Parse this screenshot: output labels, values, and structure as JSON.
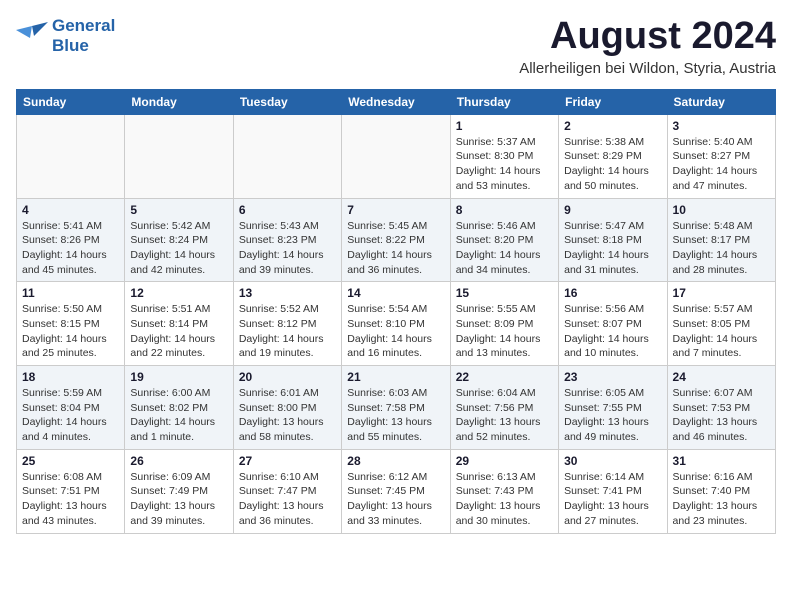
{
  "header": {
    "logo_line1": "General",
    "logo_line2": "Blue",
    "month": "August 2024",
    "location": "Allerheiligen bei Wildon, Styria, Austria"
  },
  "weekdays": [
    "Sunday",
    "Monday",
    "Tuesday",
    "Wednesday",
    "Thursday",
    "Friday",
    "Saturday"
  ],
  "weeks": [
    [
      {
        "day": "",
        "detail": ""
      },
      {
        "day": "",
        "detail": ""
      },
      {
        "day": "",
        "detail": ""
      },
      {
        "day": "",
        "detail": ""
      },
      {
        "day": "1",
        "detail": "Sunrise: 5:37 AM\nSunset: 8:30 PM\nDaylight: 14 hours\nand 53 minutes."
      },
      {
        "day": "2",
        "detail": "Sunrise: 5:38 AM\nSunset: 8:29 PM\nDaylight: 14 hours\nand 50 minutes."
      },
      {
        "day": "3",
        "detail": "Sunrise: 5:40 AM\nSunset: 8:27 PM\nDaylight: 14 hours\nand 47 minutes."
      }
    ],
    [
      {
        "day": "4",
        "detail": "Sunrise: 5:41 AM\nSunset: 8:26 PM\nDaylight: 14 hours\nand 45 minutes."
      },
      {
        "day": "5",
        "detail": "Sunrise: 5:42 AM\nSunset: 8:24 PM\nDaylight: 14 hours\nand 42 minutes."
      },
      {
        "day": "6",
        "detail": "Sunrise: 5:43 AM\nSunset: 8:23 PM\nDaylight: 14 hours\nand 39 minutes."
      },
      {
        "day": "7",
        "detail": "Sunrise: 5:45 AM\nSunset: 8:22 PM\nDaylight: 14 hours\nand 36 minutes."
      },
      {
        "day": "8",
        "detail": "Sunrise: 5:46 AM\nSunset: 8:20 PM\nDaylight: 14 hours\nand 34 minutes."
      },
      {
        "day": "9",
        "detail": "Sunrise: 5:47 AM\nSunset: 8:18 PM\nDaylight: 14 hours\nand 31 minutes."
      },
      {
        "day": "10",
        "detail": "Sunrise: 5:48 AM\nSunset: 8:17 PM\nDaylight: 14 hours\nand 28 minutes."
      }
    ],
    [
      {
        "day": "11",
        "detail": "Sunrise: 5:50 AM\nSunset: 8:15 PM\nDaylight: 14 hours\nand 25 minutes."
      },
      {
        "day": "12",
        "detail": "Sunrise: 5:51 AM\nSunset: 8:14 PM\nDaylight: 14 hours\nand 22 minutes."
      },
      {
        "day": "13",
        "detail": "Sunrise: 5:52 AM\nSunset: 8:12 PM\nDaylight: 14 hours\nand 19 minutes."
      },
      {
        "day": "14",
        "detail": "Sunrise: 5:54 AM\nSunset: 8:10 PM\nDaylight: 14 hours\nand 16 minutes."
      },
      {
        "day": "15",
        "detail": "Sunrise: 5:55 AM\nSunset: 8:09 PM\nDaylight: 14 hours\nand 13 minutes."
      },
      {
        "day": "16",
        "detail": "Sunrise: 5:56 AM\nSunset: 8:07 PM\nDaylight: 14 hours\nand 10 minutes."
      },
      {
        "day": "17",
        "detail": "Sunrise: 5:57 AM\nSunset: 8:05 PM\nDaylight: 14 hours\nand 7 minutes."
      }
    ],
    [
      {
        "day": "18",
        "detail": "Sunrise: 5:59 AM\nSunset: 8:04 PM\nDaylight: 14 hours\nand 4 minutes."
      },
      {
        "day": "19",
        "detail": "Sunrise: 6:00 AM\nSunset: 8:02 PM\nDaylight: 14 hours\nand 1 minute."
      },
      {
        "day": "20",
        "detail": "Sunrise: 6:01 AM\nSunset: 8:00 PM\nDaylight: 13 hours\nand 58 minutes."
      },
      {
        "day": "21",
        "detail": "Sunrise: 6:03 AM\nSunset: 7:58 PM\nDaylight: 13 hours\nand 55 minutes."
      },
      {
        "day": "22",
        "detail": "Sunrise: 6:04 AM\nSunset: 7:56 PM\nDaylight: 13 hours\nand 52 minutes."
      },
      {
        "day": "23",
        "detail": "Sunrise: 6:05 AM\nSunset: 7:55 PM\nDaylight: 13 hours\nand 49 minutes."
      },
      {
        "day": "24",
        "detail": "Sunrise: 6:07 AM\nSunset: 7:53 PM\nDaylight: 13 hours\nand 46 minutes."
      }
    ],
    [
      {
        "day": "25",
        "detail": "Sunrise: 6:08 AM\nSunset: 7:51 PM\nDaylight: 13 hours\nand 43 minutes."
      },
      {
        "day": "26",
        "detail": "Sunrise: 6:09 AM\nSunset: 7:49 PM\nDaylight: 13 hours\nand 39 minutes."
      },
      {
        "day": "27",
        "detail": "Sunrise: 6:10 AM\nSunset: 7:47 PM\nDaylight: 13 hours\nand 36 minutes."
      },
      {
        "day": "28",
        "detail": "Sunrise: 6:12 AM\nSunset: 7:45 PM\nDaylight: 13 hours\nand 33 minutes."
      },
      {
        "day": "29",
        "detail": "Sunrise: 6:13 AM\nSunset: 7:43 PM\nDaylight: 13 hours\nand 30 minutes."
      },
      {
        "day": "30",
        "detail": "Sunrise: 6:14 AM\nSunset: 7:41 PM\nDaylight: 13 hours\nand 27 minutes."
      },
      {
        "day": "31",
        "detail": "Sunrise: 6:16 AM\nSunset: 7:40 PM\nDaylight: 13 hours\nand 23 minutes."
      }
    ]
  ]
}
